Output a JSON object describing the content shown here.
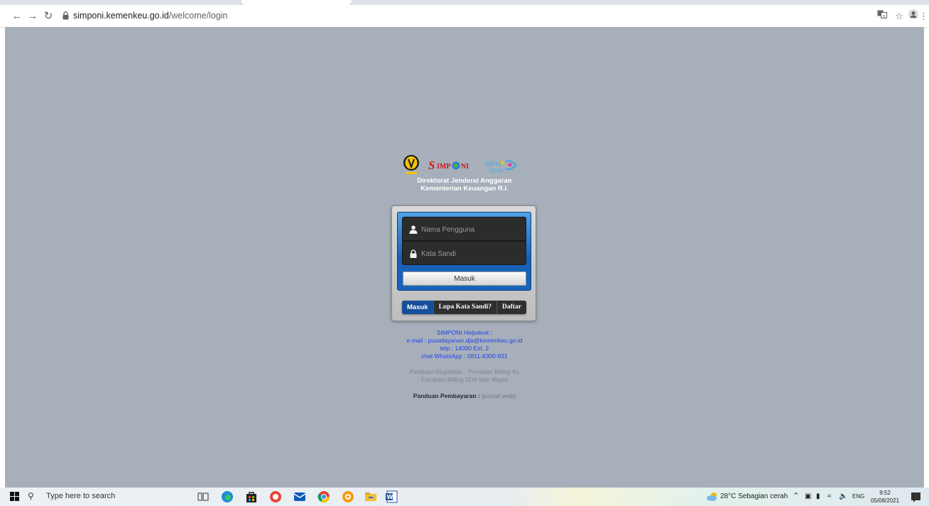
{
  "browser": {
    "url_host": "simponi.kemenkeu.go.id",
    "url_path": "/welcome/login",
    "back_icon": "back-arrow-icon",
    "forward_icon": "forward-arrow-icon",
    "reload_icon": "reload-icon"
  },
  "header": {
    "line1": "Direktorat Jenderal Anggaran",
    "line2": "Kementerian Keuangan R.I."
  },
  "logos": {
    "simponi": "SIMPONI",
    "mpn_top": "MPN",
    "mpn_bottom": "NOW"
  },
  "login": {
    "username_placeholder": "Nama Pengguna",
    "password_placeholder": "Kata Sandi",
    "submit_label": "Masuk",
    "tabs": [
      "Masuk",
      "Lupa Kata Sandi?",
      "Daftar"
    ]
  },
  "helpdesk": {
    "title_prefix": "SIMPONI ",
    "title_italic": "Helpdesk",
    "title_suffix": " :",
    "email": "e-mail : pusatlayanan.dja@kemenkeu.go.id",
    "telp": "telp : 14090 Ext. 2",
    "whatsapp": "chat WhatsApp : 0811-8300-931"
  },
  "guides": {
    "registrasi": "Panduan Registrasi",
    "billing_kl": "Panduan Billing KL",
    "billing_sda": "Panduan Billing SDA Non Migas"
  },
  "payment": {
    "label": "Panduan Pembayaran : ",
    "link": "(portal web)"
  },
  "taskbar": {
    "search_placeholder": "Type here to search",
    "weather": "28°C  Sebagian cerah",
    "language": "ENG",
    "time": "9:52",
    "date": "05/08/2021"
  },
  "colors": {
    "page_bg": "#a7afba",
    "panel_blue": "#1760b6",
    "link_blue": "#2244ee",
    "active_tab": "#164f9a"
  }
}
